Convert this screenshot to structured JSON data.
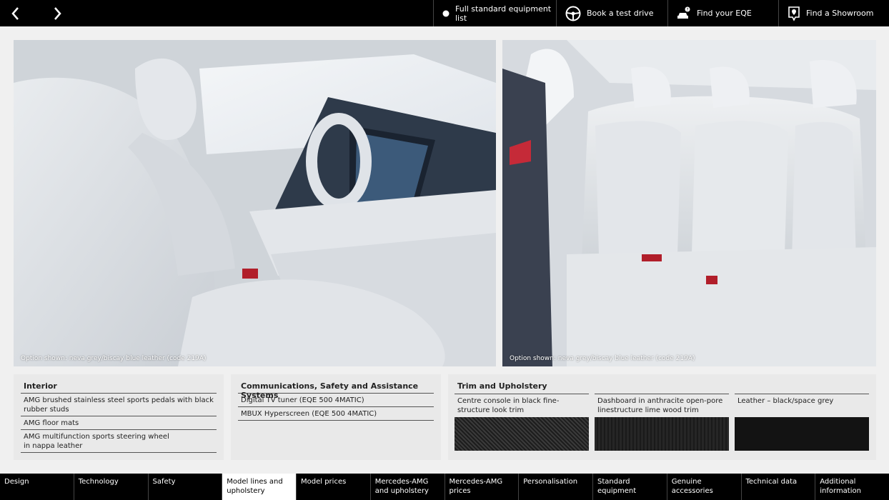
{
  "topbar": {
    "prev_icon": "chevron-left-icon",
    "next_icon": "chevron-right-icon",
    "buttons": [
      {
        "label": "Full standard equipment list",
        "icon": "dot-icon"
      },
      {
        "label": "Book a test drive",
        "icon": "steering-wheel-icon"
      },
      {
        "label": "Find your EQE",
        "icon": "car-search-icon"
      },
      {
        "label": "Find a Showroom",
        "icon": "location-pin-icon"
      }
    ]
  },
  "photos": [
    {
      "caption": "Option shown: neva grey/biscay blue leather (code 219A)"
    },
    {
      "caption": "Option shown: neva grey/biscay blue leather (code 219A)"
    }
  ],
  "panels": {
    "interior": {
      "title": "Interior",
      "items": [
        "AMG brushed stainless steel sports pedals with black rubber studs",
        "AMG floor mats",
        "AMG multifunction sports steering wheel in nappa leather"
      ]
    },
    "comms": {
      "title": "Communications, Safety and Assistance Systems",
      "items": [
        "Digital TV tuner (EQE 500 4MATIC)",
        "MBUX Hyperscreen (EQE 500 4MATIC)"
      ]
    },
    "trim": {
      "title": "Trim and Upholstery",
      "items": [
        {
          "label": "Centre console in black fine-structure look trim",
          "color": "#2b2b2b"
        },
        {
          "label": "Dashboard in anthracite open-pore linestructure lime wood trim",
          "color": "#1e1e1e"
        },
        {
          "label": "Leather – black/space grey",
          "color": "#111111"
        }
      ]
    }
  },
  "bottomnav": [
    {
      "label": "Design"
    },
    {
      "label": "Technology"
    },
    {
      "label": "Safety"
    },
    {
      "label": "Model lines and upholstery"
    },
    {
      "label": "Model prices"
    },
    {
      "label": "Mercedes-AMG and upholstery"
    },
    {
      "label": "Mercedes-AMG prices"
    },
    {
      "label": "Personalisation"
    },
    {
      "label": "Standard equipment"
    },
    {
      "label": "Genuine accessories"
    },
    {
      "label": "Technical data"
    },
    {
      "label": "Additional information"
    }
  ]
}
